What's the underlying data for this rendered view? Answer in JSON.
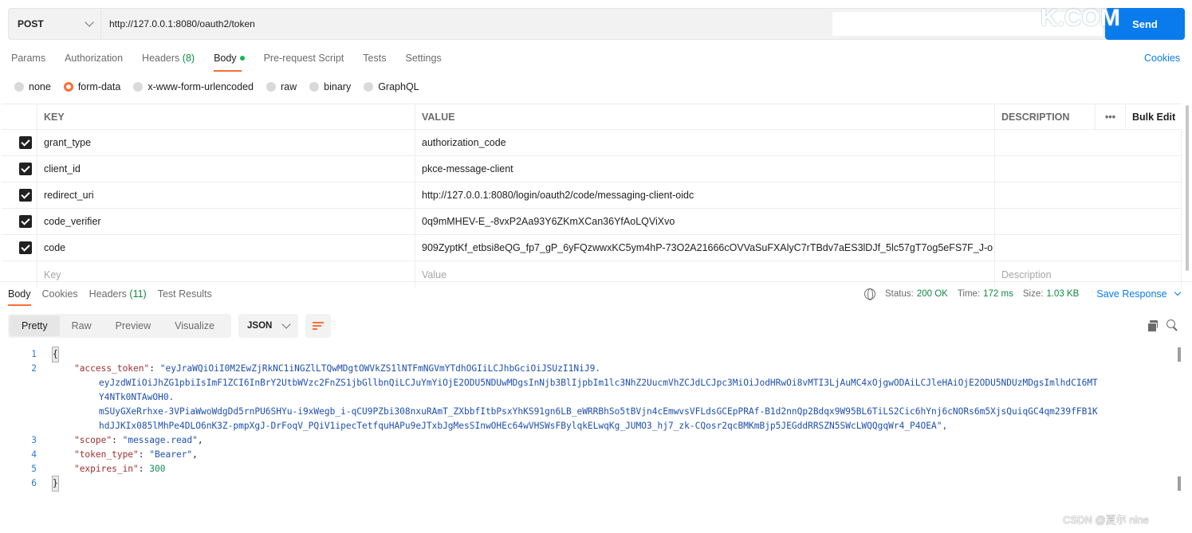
{
  "request": {
    "method": "POST",
    "url": "http://127.0.0.1:8080/oauth2/token",
    "send_label": "Send"
  },
  "watermark_top": "K.COM",
  "watermark_bottom": "CSDN @夏尔 nine",
  "request_tabs": [
    {
      "label": "Params"
    },
    {
      "label": "Authorization"
    },
    {
      "label": "Headers",
      "count": "(8)"
    },
    {
      "label": "Body"
    },
    {
      "label": "Pre-request Script"
    },
    {
      "label": "Tests"
    },
    {
      "label": "Settings"
    }
  ],
  "cookies_link": "Cookies",
  "body_types": [
    "none",
    "form-data",
    "x-www-form-urlencoded",
    "raw",
    "binary",
    "GraphQL"
  ],
  "params_table": {
    "headers": {
      "key": "KEY",
      "value": "VALUE",
      "description": "DESCRIPTION",
      "bulk_edit": "Bulk Edit",
      "more": "•••"
    },
    "rows": [
      {
        "key": "grant_type",
        "value": "authorization_code"
      },
      {
        "key": "client_id",
        "value": "pkce-message-client"
      },
      {
        "key": "redirect_uri",
        "value": "http://127.0.0.1:8080/login/oauth2/code/messaging-client-oidc"
      },
      {
        "key": "code_verifier",
        "value": "0q9mMHEV-E_-8vxP2Aa93Y6ZKmXCan36YfAoLQViXvo"
      },
      {
        "key": "code",
        "value": "909ZyptKf_etbsi8eQG_fp7_gP_6yFQzwwxKC5ym4hP-73O2A21666cOVVaSuFXAlyC7rTBdv7aES3lDJf_5lc57gT7og5eFS7F_J-o"
      }
    ],
    "placeholders": {
      "key": "Key",
      "value": "Value",
      "description": "Description"
    }
  },
  "response_tabs": [
    {
      "label": "Body"
    },
    {
      "label": "Cookies"
    },
    {
      "label": "Headers",
      "count": "(11)"
    },
    {
      "label": "Test Results"
    }
  ],
  "response_status": {
    "status_label": "Status:",
    "status_value": "200 OK",
    "time_label": "Time:",
    "time_value": "172 ms",
    "size_label": "Size:",
    "size_value": "1.03 KB",
    "save_response": "Save Response"
  },
  "format_tabs": [
    "Pretty",
    "Raw",
    "Preview",
    "Visualize"
  ],
  "format_select": "JSON",
  "response_body": {
    "line_numbers": [
      "1",
      "2",
      "3",
      "4",
      "5",
      "6"
    ],
    "open_brace": "{",
    "close_brace": "}",
    "access_token_key": "\"access_token\"",
    "access_token_lines": [
      "\"eyJraWQiOiI0M2EwZjRkNC1iNGZlLTQwMDgtOWVkZS1lNTFmNGVmYTdhOGIiLCJhbGciOiJSUzI1NiJ9.",
      "eyJzdWIiOiJhZG1pbiIsImF1ZCI6InBrY2UtbWVzc2FnZS1jbGllbnQiLCJuYmYiOjE2ODU5NDUwMDgsInNjb3BlIjpbIm1lc3NhZ2UucmVhZCJdLCJpc3MiOiJodHRwOi8vMTI3LjAuMC4xOjgwODAiLCJleHAiOjE2ODU5NDUzMDgsImlhdCI6MT",
      "Y4NTk0NTAwOH0.",
      "mSUyGXeRrhxe-3VPiaWwoWdgDd5rnPU6SHYu-i9xWegb_i-qCU9PZbi308nxuRAmT_ZXbbfItbPsxYhKS91gn6LB_eWRRBhSo5tBVjn4cEmwvsVFLdsGCEpPRAf-B1d2nnQp2Bdqx9W95BL6TiLS2Cic6hYnj6cNORs6m5XjsQuiqGC4qm239fFB1K",
      "hdJJKIx085lMhPe4DLO6nK3Z-pmpXgJ-DrFoqV_PQiV1ipecTetfquHAPu9eJTxbJgMesSInwOHEc64wVHSWsFBylqkELwqKg_JUMO3_hj7_zk-CQosr2qcBMKmBjp5JEGddRRSZN5SWcLWQQgqWr4_P4OEA\","
    ],
    "scope_key": "\"scope\"",
    "scope_value": "\"message.read\"",
    "token_type_key": "\"token_type\"",
    "token_type_value": "\"Bearer\"",
    "expires_in_key": "\"expires_in\"",
    "expires_in_value": "300"
  },
  "colors": {
    "accent": "#ff6c37",
    "primary": "#097bed",
    "success": "#0d8a3f"
  }
}
